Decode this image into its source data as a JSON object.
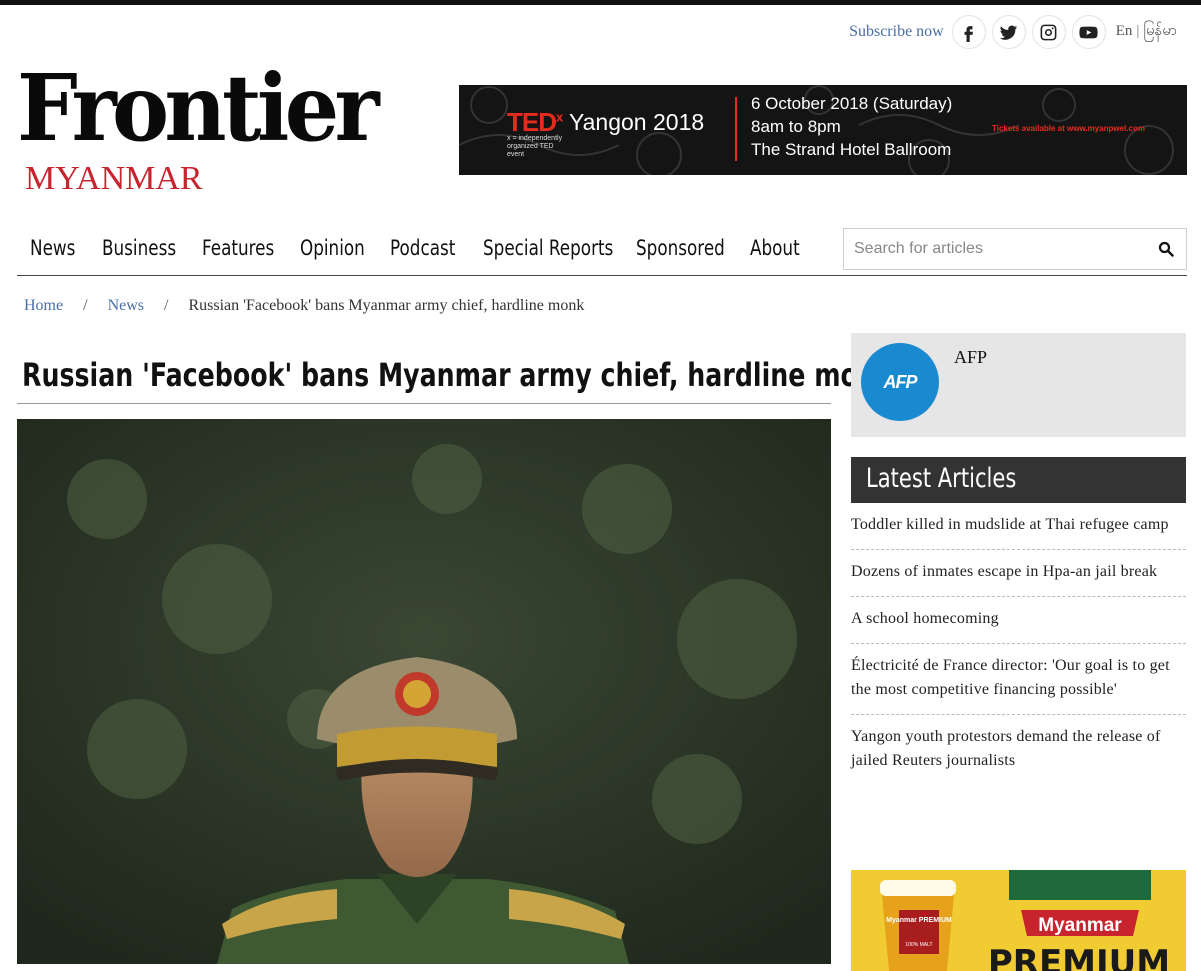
{
  "header": {
    "subscribe_label": "Subscribe now",
    "social": [
      "facebook-icon",
      "twitter-icon",
      "instagram-icon",
      "youtube-icon"
    ],
    "lang_en": "En",
    "lang_sep": "|",
    "lang_mm": "မြန်မာ"
  },
  "logo": {
    "main": "Frontier",
    "sub": "MYANMAR"
  },
  "banner": {
    "ted": "TED",
    "ted_x": "x",
    "ted_sub": "x = independently organized TED event",
    "yangon": "Yangon 2018",
    "line1": "6 October 2018 (Saturday)",
    "line2": "8am to 8pm",
    "line3": "The Strand Hotel Ballroom",
    "tickets": "Tickets available at www.myanpwel.com"
  },
  "nav": {
    "items": [
      "News",
      "Business",
      "Features",
      "Opinion",
      "Podcast",
      "Special Reports",
      "Sponsored",
      "About"
    ],
    "search_placeholder": "Search for articles"
  },
  "breadcrumb": {
    "home": "Home",
    "news": "News",
    "current": "Russian 'Facebook' bans Myanmar army chief, hardline monk"
  },
  "article": {
    "title": "Russian 'Facebook' bans Myanmar army chief, hardline monk"
  },
  "author": {
    "logo_text": "AFP",
    "name": "AFP"
  },
  "sidebar": {
    "latest_heading": "Latest Articles",
    "articles": [
      "Toddler killed in mudslide at Thai refugee camp",
      "Dozens of inmates escape in Hpa-an jail break",
      "A school homecoming",
      "Électricité de France director: 'Our goal is to get the most competitive financing possible'",
      "Yangon youth protestors demand the release of jailed Reuters journalists"
    ]
  },
  "ad": {
    "brand": "Myanmar",
    "product": "PREMIUM",
    "glass_label": "Myanmar PREMIUM",
    "glass_sub": "100% MALT"
  },
  "colors": {
    "brand_red": "#c8242e",
    "link_blue": "#4a6fa5",
    "afp_blue": "#1a8ad0",
    "ted_red": "#e62b1e"
  }
}
